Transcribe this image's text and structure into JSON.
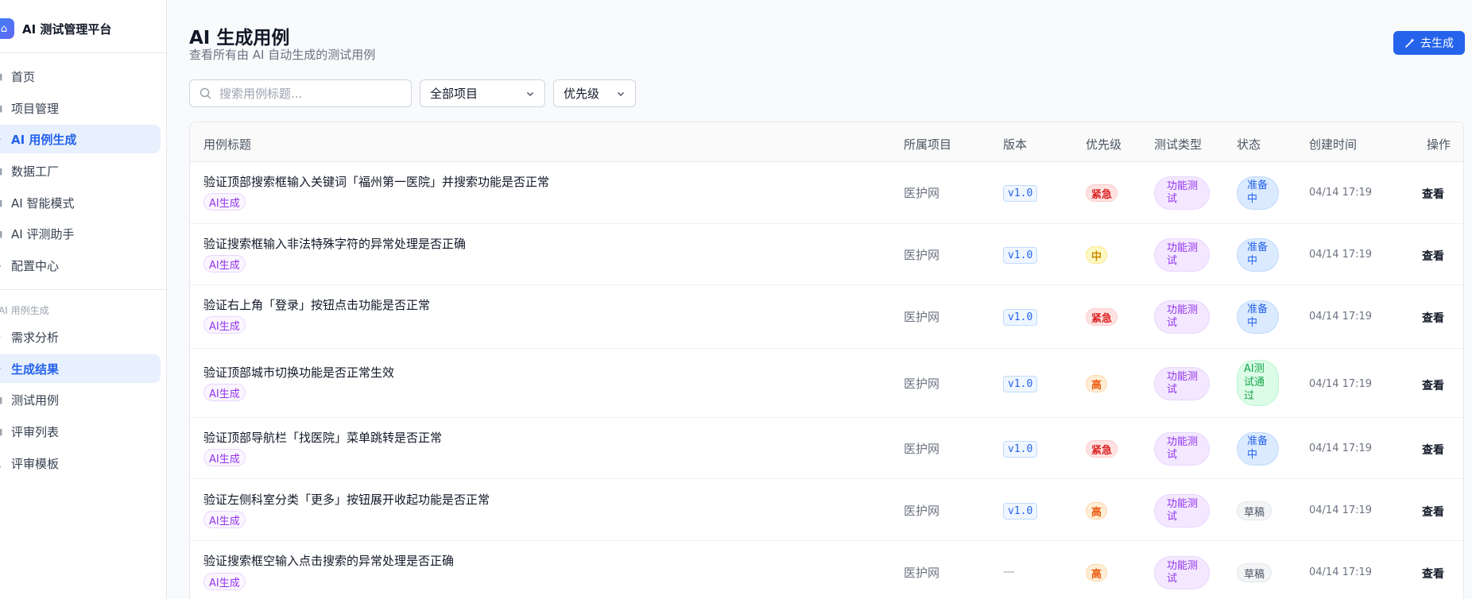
{
  "app": {
    "title": "AI 测试管理平台",
    "logo_icon": "robot-icon"
  },
  "sidebar": {
    "items": [
      {
        "label": "首页",
        "icon": "home-icon"
      },
      {
        "label": "项目管理",
        "icon": "folder-icon"
      },
      {
        "label": "AI 用例生成",
        "icon": "sparkle-icon",
        "active": true
      },
      {
        "label": "数据工厂",
        "icon": "database-icon"
      },
      {
        "label": "AI 智能模式",
        "icon": "brain-icon"
      },
      {
        "label": "AI 评测助手",
        "icon": "assistant-icon"
      },
      {
        "label": "配置中心",
        "icon": "settings-icon"
      }
    ],
    "section_label": "AI 用例生成",
    "sub_items": [
      {
        "label": "需求分析",
        "icon": "analysis-icon"
      },
      {
        "label": "生成结果",
        "icon": "sparkle-icon",
        "active": true
      },
      {
        "label": "测试用例",
        "icon": "list-icon"
      },
      {
        "label": "评审列表",
        "icon": "review-icon"
      },
      {
        "label": "评审模板",
        "icon": "template-icon"
      }
    ]
  },
  "page": {
    "title": "AI 生成用例",
    "subtitle": "查看所有由 AI 自动生成的测试用例",
    "generate_button": "去生成"
  },
  "filters": {
    "search_placeholder": "搜索用例标题...",
    "project_select": "全部项目",
    "priority_select": "优先级"
  },
  "table": {
    "headers": [
      "用例标题",
      "所属项目",
      "版本",
      "优先级",
      "测试类型",
      "状态",
      "创建时间",
      "操作"
    ],
    "rows": [
      {
        "title": "验证顶部搜索框输入关键词「福州第一医院」并搜索功能是否正常",
        "tag": "AI生成",
        "project": "医护网",
        "version": "v1.0",
        "priority": "紧急",
        "type_l1": "功能测",
        "type_l2": "试",
        "status_l1": "准备",
        "status_l2": "中",
        "status_l3": "",
        "time": "04/14 17:19",
        "action": "查看"
      },
      {
        "title": "验证搜索框输入非法特殊字符的异常处理是否正确",
        "tag": "AI生成",
        "project": "医护网",
        "version": "v1.0",
        "priority": "中",
        "type_l1": "功能测",
        "type_l2": "试",
        "status_l1": "准备",
        "status_l2": "中",
        "status_l3": "",
        "time": "04/14 17:19",
        "action": "查看"
      },
      {
        "title": "验证右上角「登录」按钮点击功能是否正常",
        "tag": "AI生成",
        "project": "医护网",
        "version": "v1.0",
        "priority": "紧急",
        "type_l1": "功能测",
        "type_l2": "试",
        "status_l1": "准备",
        "status_l2": "中",
        "status_l3": "",
        "time": "04/14 17:19",
        "action": "查看"
      },
      {
        "title": "验证顶部城市切换功能是否正常生效",
        "tag": "AI生成",
        "project": "医护网",
        "version": "v1.0",
        "priority": "高",
        "type_l1": "功能测",
        "type_l2": "试",
        "status_l1": "AI测",
        "status_l2": "试通",
        "status_l3": "过",
        "time": "04/14 17:19",
        "action": "查看"
      },
      {
        "title": "验证顶部导航栏「找医院」菜单跳转是否正常",
        "tag": "AI生成",
        "project": "医护网",
        "version": "v1.0",
        "priority": "紧急",
        "type_l1": "功能测",
        "type_l2": "试",
        "status_l1": "准备",
        "status_l2": "中",
        "status_l3": "",
        "time": "04/14 17:19",
        "action": "查看"
      },
      {
        "title": "验证左侧科室分类「更多」按钮展开收起功能是否正常",
        "tag": "AI生成",
        "project": "医护网",
        "version": "v1.0",
        "priority": "高",
        "type_l1": "功能测",
        "type_l2": "试",
        "status": "草稿",
        "time": "04/14 17:19",
        "action": "查看"
      },
      {
        "title": "验证搜索框空输入点击搜索的异常处理是否正确",
        "tag": "AI生成",
        "project": "医护网",
        "version": "—",
        "priority": "高",
        "type_l1": "功能测",
        "type_l2": "试",
        "status": "草稿",
        "time": "04/14 17:19",
        "action": "查看"
      }
    ]
  },
  "colors": {
    "accent": "#2563eb",
    "priority_urgent": "#dc2626",
    "priority_high": "#ea580c",
    "priority_medium": "#ca8a04",
    "status_ready": "#2563eb",
    "status_passed": "#16a34a"
  }
}
